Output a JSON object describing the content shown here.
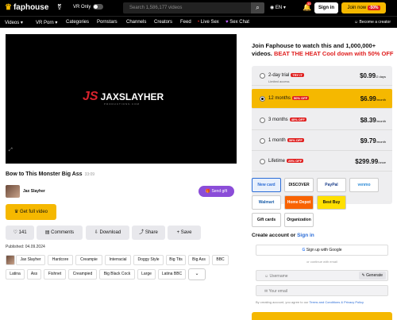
{
  "header": {
    "logo_text": "faphouse",
    "gender_icon": "⚧",
    "vr_only_label": "VR Only",
    "search_placeholder": "Search 1,586,177 videos",
    "lang": "EN",
    "notif_count": "30",
    "signin_label": "Sign in",
    "join_label": "Join now",
    "join_badge": "-50%"
  },
  "nav": {
    "items": [
      "Videos",
      "VR Porn",
      "Categories",
      "Pornstars",
      "Channels",
      "Creators",
      "Feed",
      "Live Sex",
      "Sex Chat"
    ],
    "become_creator": "Become a creator"
  },
  "video": {
    "brand_text": "JAXSLAYHER",
    "brand_mark": "JS",
    "brand_sub": "PRODUCTIONS.COM",
    "title": "Bow to This Monster Big Ass",
    "duration": "33:09",
    "creator": "Jax Slayher",
    "send_gift": "Send gift",
    "full_video": "Get full video",
    "likes": "141",
    "comments": "Comments",
    "download": "Download",
    "share": "Share",
    "save": "Save",
    "published": "Published: 04.09.2024",
    "tags_row1": [
      "Jax Slayher",
      "Hardcore",
      "Creampie",
      "Interracial",
      "Doggy Style",
      "Big Tits",
      "Big Ass",
      "BBC"
    ],
    "tags_row2": [
      "Latina",
      "Ass",
      "Fishnet",
      "Creampied",
      "Big Black Cock",
      "Large",
      "Latina BBC"
    ]
  },
  "join_panel": {
    "title": "Join Faphouse to watch this and 1,000,000+ videos.",
    "title_red": "BEAT THE HEAT Cool down with 50% OFF",
    "plans": [
      {
        "name": "2-day trial",
        "badge": "TRY IT",
        "sub": "Limited access",
        "price": "$0.99",
        "per": "/2 days",
        "selected": false
      },
      {
        "name": "12 months",
        "badge": "50% OFF",
        "sub": "",
        "price": "$6.99",
        "per": "/month",
        "selected": true
      },
      {
        "name": "3 months",
        "badge": "40% OFF",
        "sub": "",
        "price": "$8.39",
        "per": "/month",
        "selected": false
      },
      {
        "name": "1 month",
        "badge": "30% OFF",
        "sub": "",
        "price": "$9.79",
        "per": "/month",
        "selected": false
      },
      {
        "name": "Lifetime",
        "badge": "25% OFF",
        "sub": "",
        "price": "$299.99",
        "per": "/once",
        "selected": false
      }
    ],
    "payments": [
      "New card",
      "DISCOVER",
      "PayPal",
      "venmo",
      "Walmart",
      "Home Depot",
      "Best Buy",
      "Gift cards",
      "Organization"
    ],
    "create_account": "Create account or",
    "signin_link": "Sign in",
    "google": "Sign up with Google",
    "or_email": "or continue with email",
    "username_placeholder": "Username",
    "generate": "Generate",
    "email_placeholder": "Your email",
    "legal": "By creating account, you agree to our",
    "legal_link": "Terms and Conditions & Privacy Policy"
  }
}
